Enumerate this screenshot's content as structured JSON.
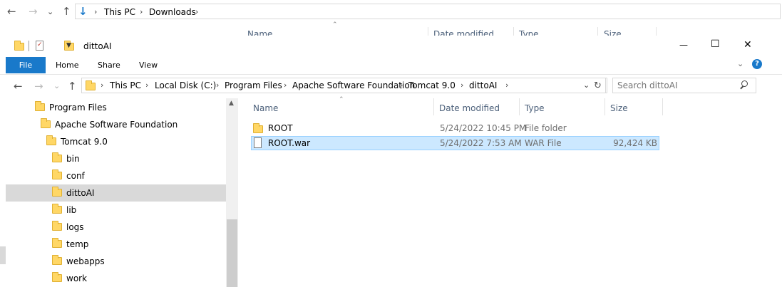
{
  "bg_window": {
    "breadcrumb": [
      "This PC",
      "Downloads"
    ],
    "columns": [
      "Name",
      "Date modified",
      "Type",
      "Size"
    ]
  },
  "window": {
    "title": "dittoAI",
    "controls": {
      "minimize": "—",
      "maximize": "☐",
      "close": "✕"
    }
  },
  "ribbon": {
    "tabs": [
      "File",
      "Home",
      "Share",
      "View"
    ]
  },
  "address": {
    "crumbs": [
      "This PC",
      "Local Disk (C:)",
      "Program Files",
      "Apache Software Foundation",
      "Tomcat 9.0",
      "dittoAI"
    ],
    "search_placeholder": "Search dittoAI"
  },
  "tree": [
    {
      "label": "Program Files"
    },
    {
      "label": "Apache Software Foundation"
    },
    {
      "label": "Tomcat 9.0"
    },
    {
      "label": "bin"
    },
    {
      "label": "conf"
    },
    {
      "label": "dittoAI",
      "selected": true
    },
    {
      "label": "lib"
    },
    {
      "label": "logs"
    },
    {
      "label": "temp"
    },
    {
      "label": "webapps"
    },
    {
      "label": "work"
    }
  ],
  "file_list": {
    "headers": {
      "name": "Name",
      "date": "Date modified",
      "type": "Type",
      "size": "Size"
    },
    "rows": [
      {
        "name": "ROOT",
        "date": "5/24/2022 10:45 PM",
        "type": "File folder",
        "size": "",
        "icon": "folder-icon"
      },
      {
        "name": "ROOT.war",
        "date": "5/24/2022 7:53 AM",
        "type": "WAR File",
        "size": "92,424 KB",
        "icon": "file-icon",
        "selected": true
      }
    ]
  },
  "colors": {
    "accent": "#1979ca",
    "selection": "#cce8ff",
    "tree_selected": "#d9d9d9"
  }
}
